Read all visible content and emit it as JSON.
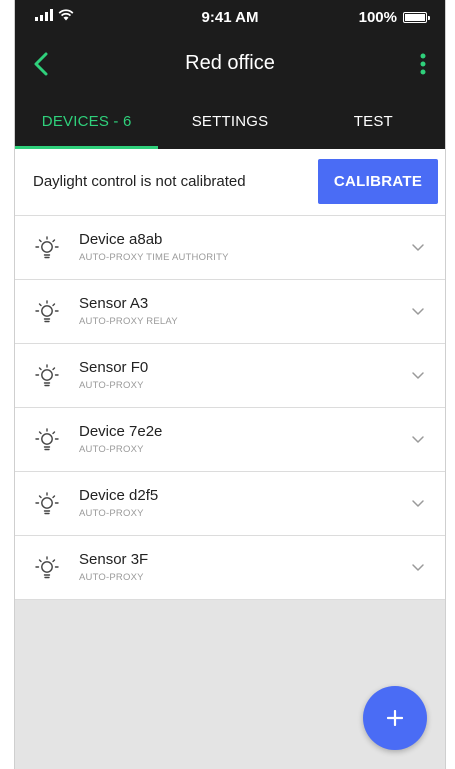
{
  "status_bar": {
    "time": "9:41 AM",
    "battery": "100%"
  },
  "app_bar": {
    "title": "Red office"
  },
  "tabs": [
    {
      "label": "DEVICES - 6",
      "active": true
    },
    {
      "label": "SETTINGS",
      "active": false
    },
    {
      "label": "TEST",
      "active": false
    }
  ],
  "calibration": {
    "message": "Daylight control is not calibrated",
    "button_label": "CALIBRATE"
  },
  "devices": [
    {
      "name": "Device a8ab",
      "tags": "AUTO-PROXY  TIME AUTHORITY"
    },
    {
      "name": "Sensor A3",
      "tags": "AUTO-PROXY  RELAY"
    },
    {
      "name": "Sensor F0",
      "tags": "AUTO-PROXY"
    },
    {
      "name": "Device 7e2e",
      "tags": "AUTO-PROXY"
    },
    {
      "name": "Device d2f5",
      "tags": "AUTO-PROXY"
    },
    {
      "name": "Sensor 3F",
      "tags": "AUTO-PROXY"
    }
  ],
  "colors": {
    "accent_green": "#2fd07b",
    "primary_blue": "#4a6cf5",
    "header_bg": "#1c1c1c"
  },
  "icons": {
    "back": "chevron-left-icon",
    "more": "more-vertical-icon",
    "device": "light-bulb-icon",
    "expand": "chevron-down-icon",
    "fab": "plus-icon"
  }
}
